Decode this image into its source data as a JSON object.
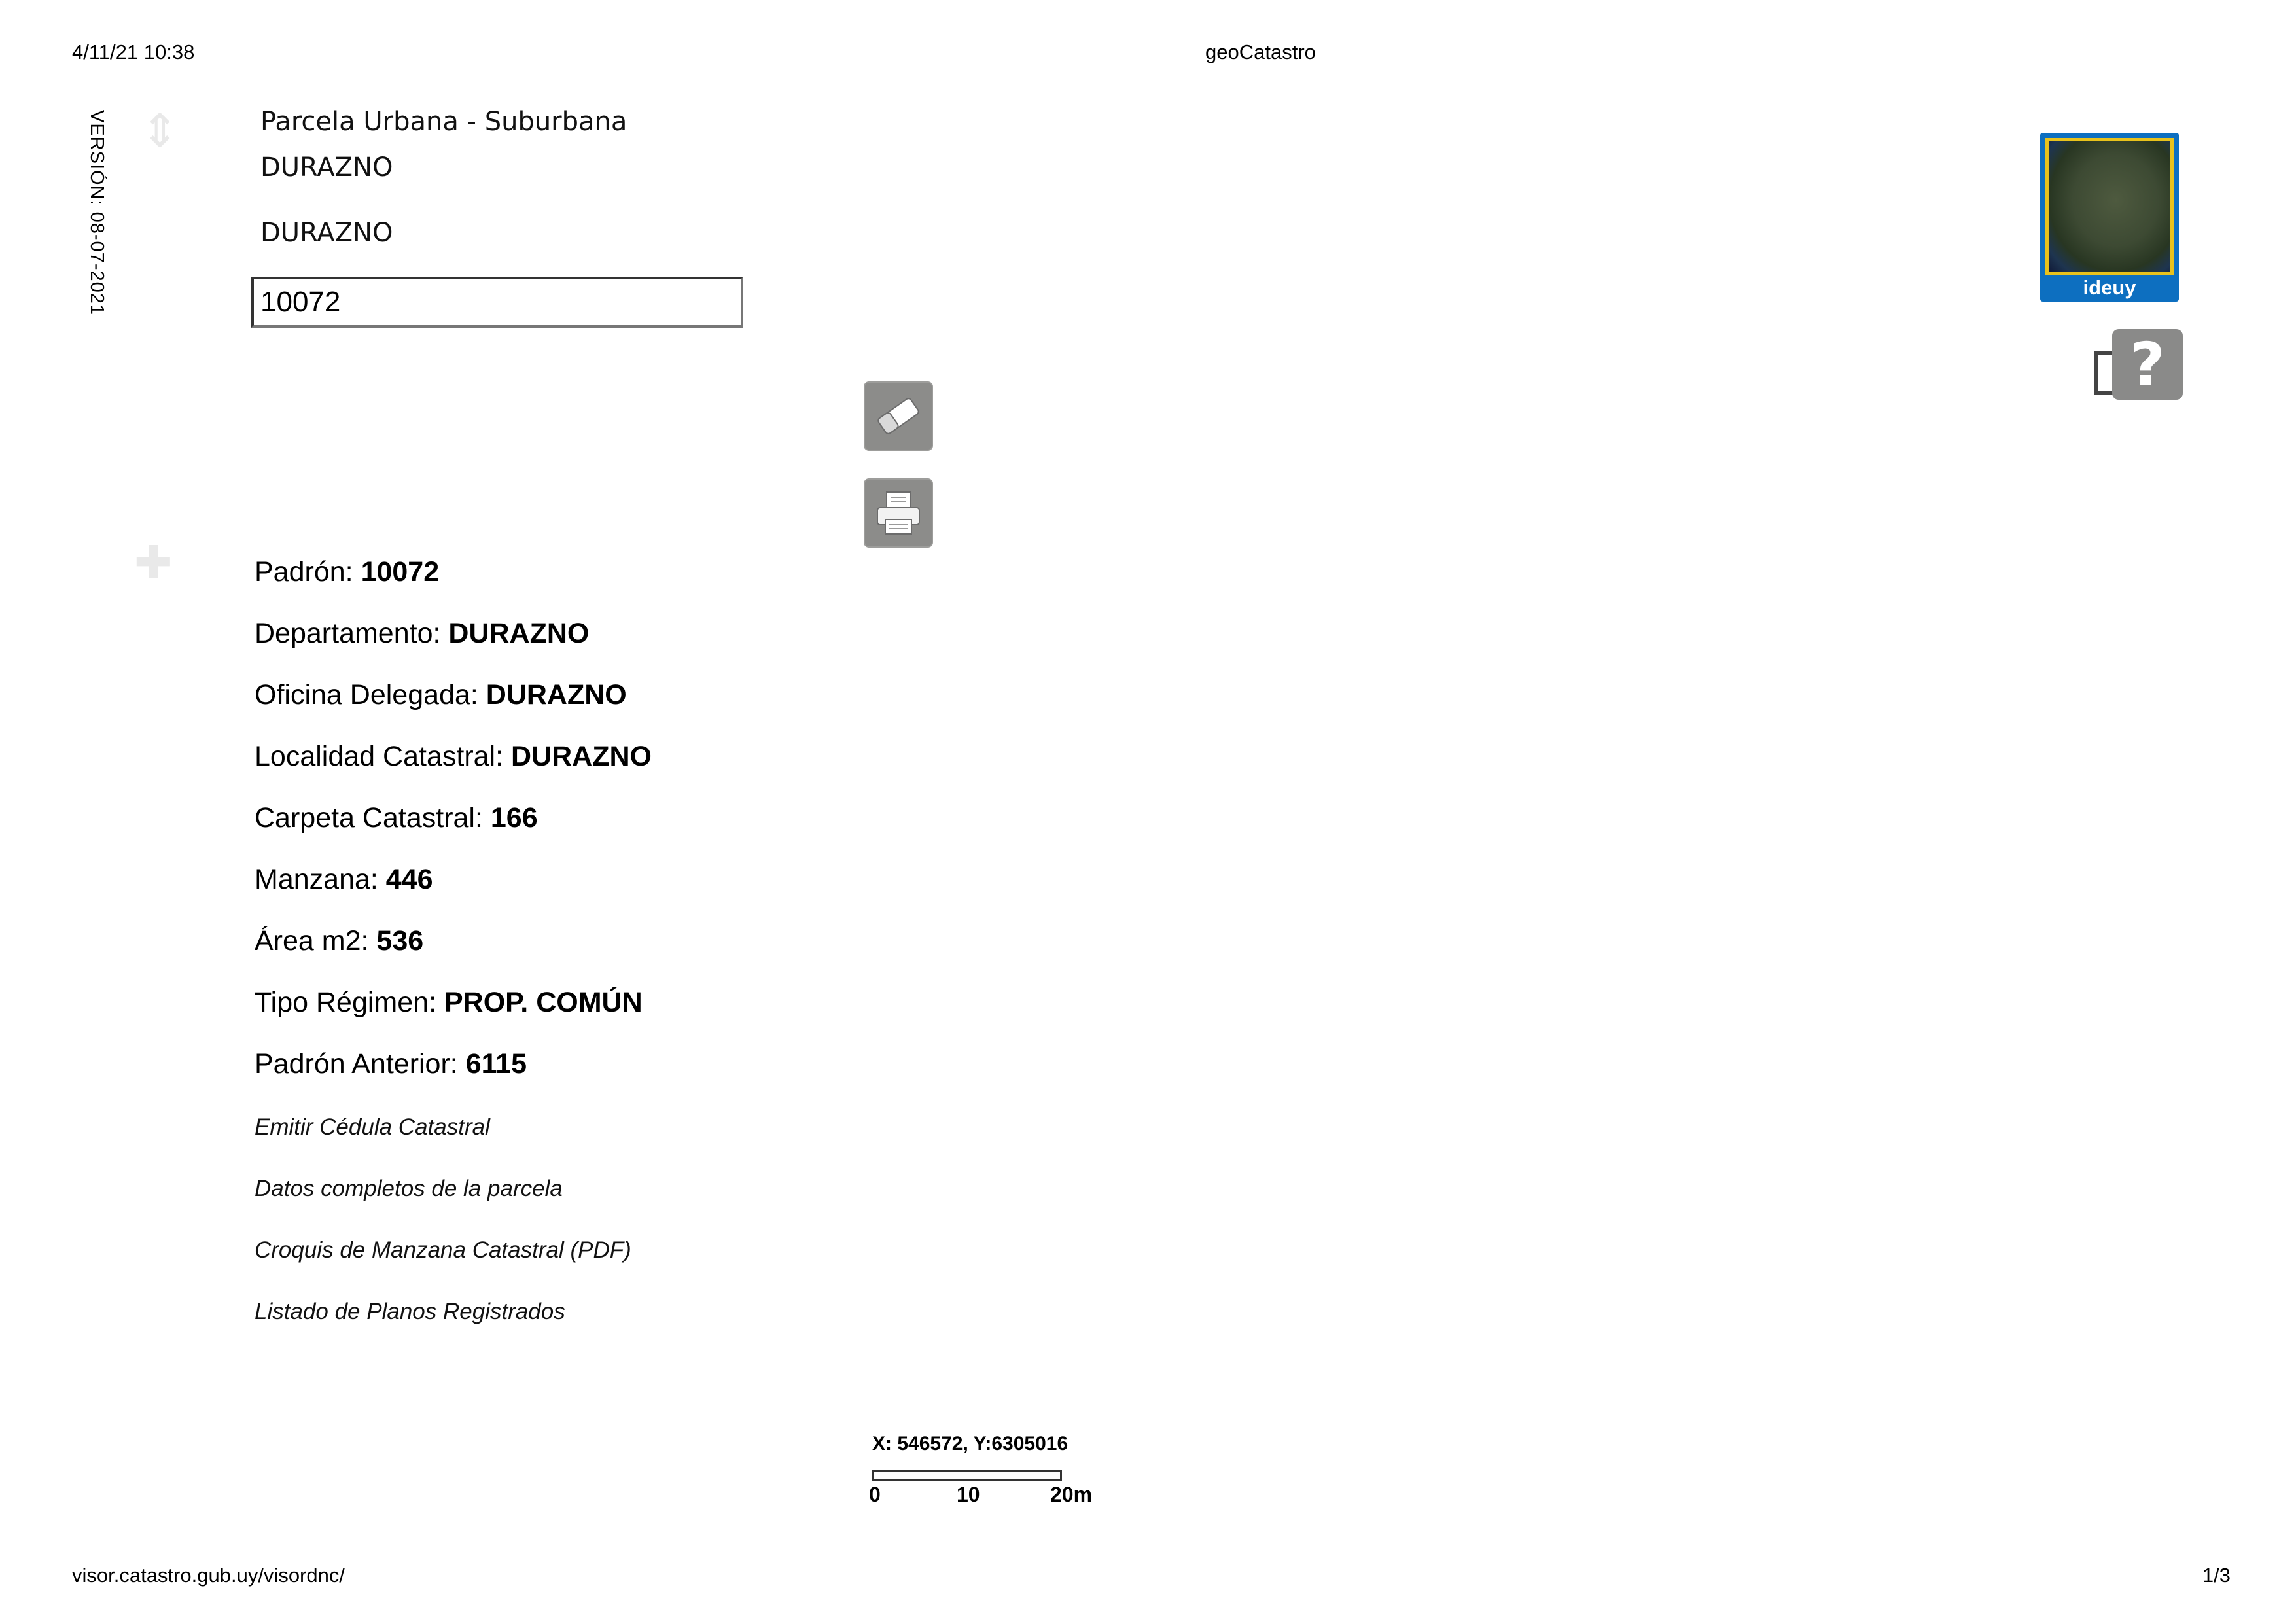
{
  "print_header": {
    "datetime": "4/11/21 10:38",
    "page_title": "geoCatastro"
  },
  "print_footer": {
    "url": "visor.catastro.gub.uy/visordnc/",
    "page_number": "1/3"
  },
  "version": "VERSIÓN: 08-07-2021",
  "search": {
    "tipo_parcela": "Parcela Urbana - Suburbana",
    "departamento": "DURAZNO",
    "localidad": "DURAZNO",
    "padron_value": "10072"
  },
  "tools": {
    "erase_icon": "eraser-icon",
    "print_icon": "printer-icon"
  },
  "result": {
    "padron": {
      "label": "Padrón: ",
      "value": "10072"
    },
    "departamento": {
      "label": "Departamento: ",
      "value": "DURAZNO"
    },
    "oficina": {
      "label": "Oficina Delegada: ",
      "value": "DURAZNO"
    },
    "localidad": {
      "label": "Localidad Catastral: ",
      "value": "DURAZNO"
    },
    "carpeta": {
      "label": "Carpeta Catastral: ",
      "value": "166"
    },
    "manzana": {
      "label": "Manzana: ",
      "value": "446"
    },
    "area": {
      "label": "Área m2: ",
      "value": "536"
    },
    "tipo_regimen": {
      "label": "Tipo Régimen: ",
      "value": "PROP. COMÚN"
    },
    "padron_anterior": {
      "label": "Padrón Anterior: ",
      "value": "6115"
    }
  },
  "links": {
    "cedula": "Emitir Cédula Catastral",
    "datos": "Datos completos de la parcela",
    "croquis": "Croquis de Manzana Catastral (PDF)",
    "planos": "Listado de Planos Registrados"
  },
  "basemap": {
    "label": "ideuy"
  },
  "help": {
    "symbol": "?"
  },
  "map_status": {
    "coordinates": "X: 546572, Y:6305016",
    "scale_ticks": [
      "0",
      "10",
      "20m"
    ]
  },
  "colors": {
    "button_gray": "#8c8c8a",
    "ideuy_blue": "#0d6fc0",
    "ideuy_border": "#e8c21c"
  }
}
